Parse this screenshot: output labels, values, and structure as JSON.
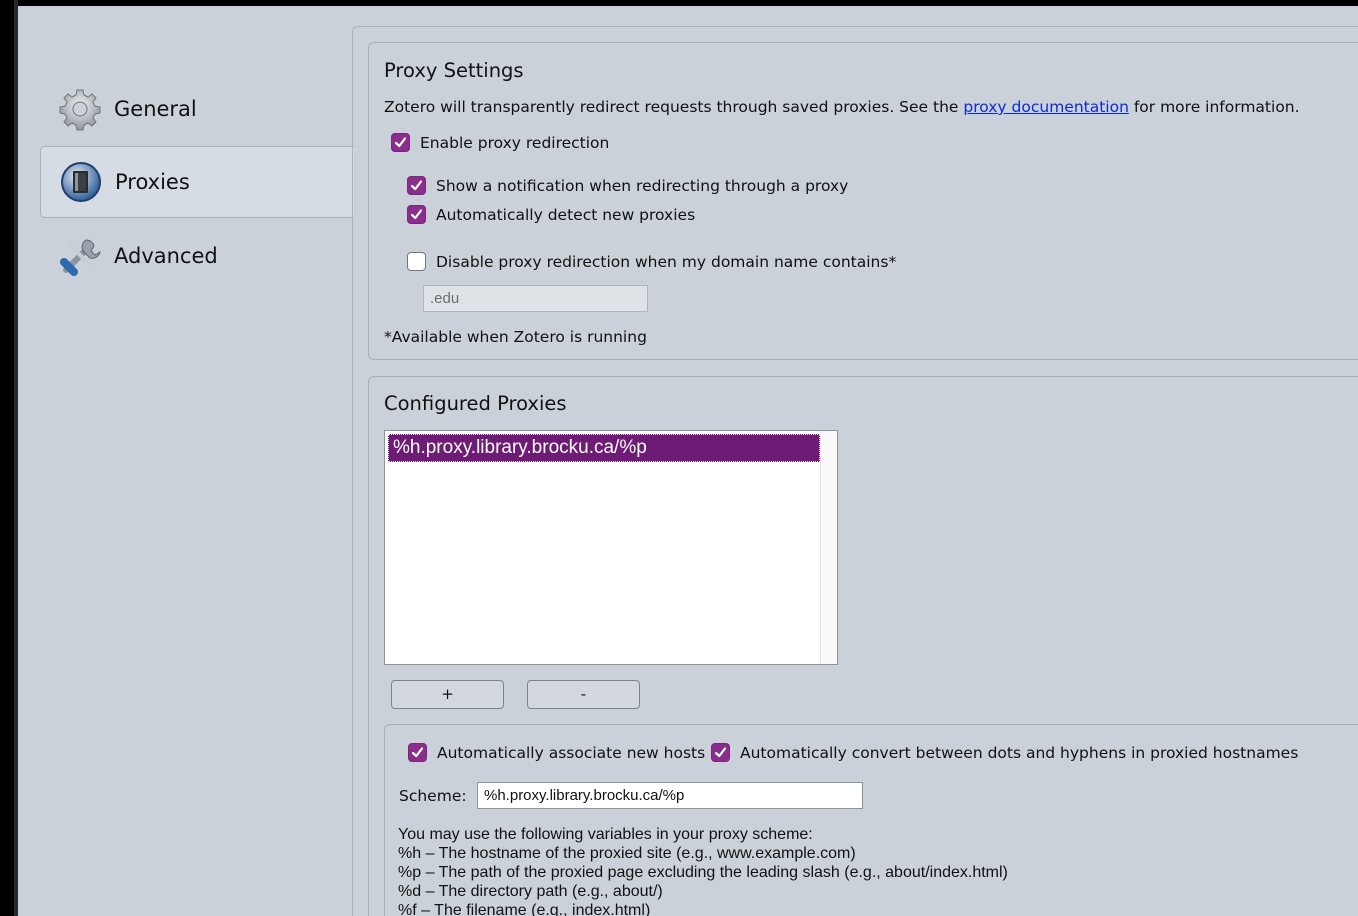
{
  "sidebar": {
    "items": [
      {
        "label": "General",
        "icon": "gear-icon"
      },
      {
        "label": "Proxies",
        "icon": "proxy-icon"
      },
      {
        "label": "Advanced",
        "icon": "tools-icon"
      }
    ],
    "selected": "Proxies"
  },
  "proxy_settings": {
    "title": "Proxy Settings",
    "desc_before": "Zotero will transparently redirect requests through saved proxies. See the ",
    "desc_link": "proxy documentation",
    "desc_after": " for more information.",
    "enable_redirection": {
      "label": "Enable proxy redirection",
      "checked": true
    },
    "show_notification": {
      "label": "Show a notification when redirecting through a proxy",
      "checked": true
    },
    "auto_detect": {
      "label": "Automatically detect new proxies",
      "checked": true
    },
    "disable_domain": {
      "label": "Disable proxy redirection when my domain name contains*",
      "checked": false
    },
    "domain_value": ".edu",
    "footnote": "*Available when Zotero is running"
  },
  "configured_proxies": {
    "title": "Configured Proxies",
    "items": [
      "%h.proxy.library.brocku.ca/%p"
    ],
    "add_label": "+",
    "remove_label": "-"
  },
  "proxy_detail": {
    "auto_associate": {
      "label": "Automatically associate new hosts",
      "checked": true
    },
    "auto_convert": {
      "label": "Automatically convert between dots and hyphens in proxied hostnames",
      "checked": true
    },
    "scheme_label": "Scheme:",
    "scheme_value": "%h.proxy.library.brocku.ca/%p",
    "variables_intro": "You may use the following variables in your proxy scheme:",
    "variables": [
      "%h – The hostname of the proxied site (e.g., www.example.com)",
      "%p – The path of the proxied page excluding the leading slash (e.g., about/index.html)",
      "%d – The directory path (e.g., about/)",
      "%f – The filename (e.g., index.html)"
    ]
  },
  "colors": {
    "accent": "#8a2e8c",
    "selection": "#6d1b74",
    "link": "#0a2bd6",
    "background": "#cbd1d9"
  }
}
